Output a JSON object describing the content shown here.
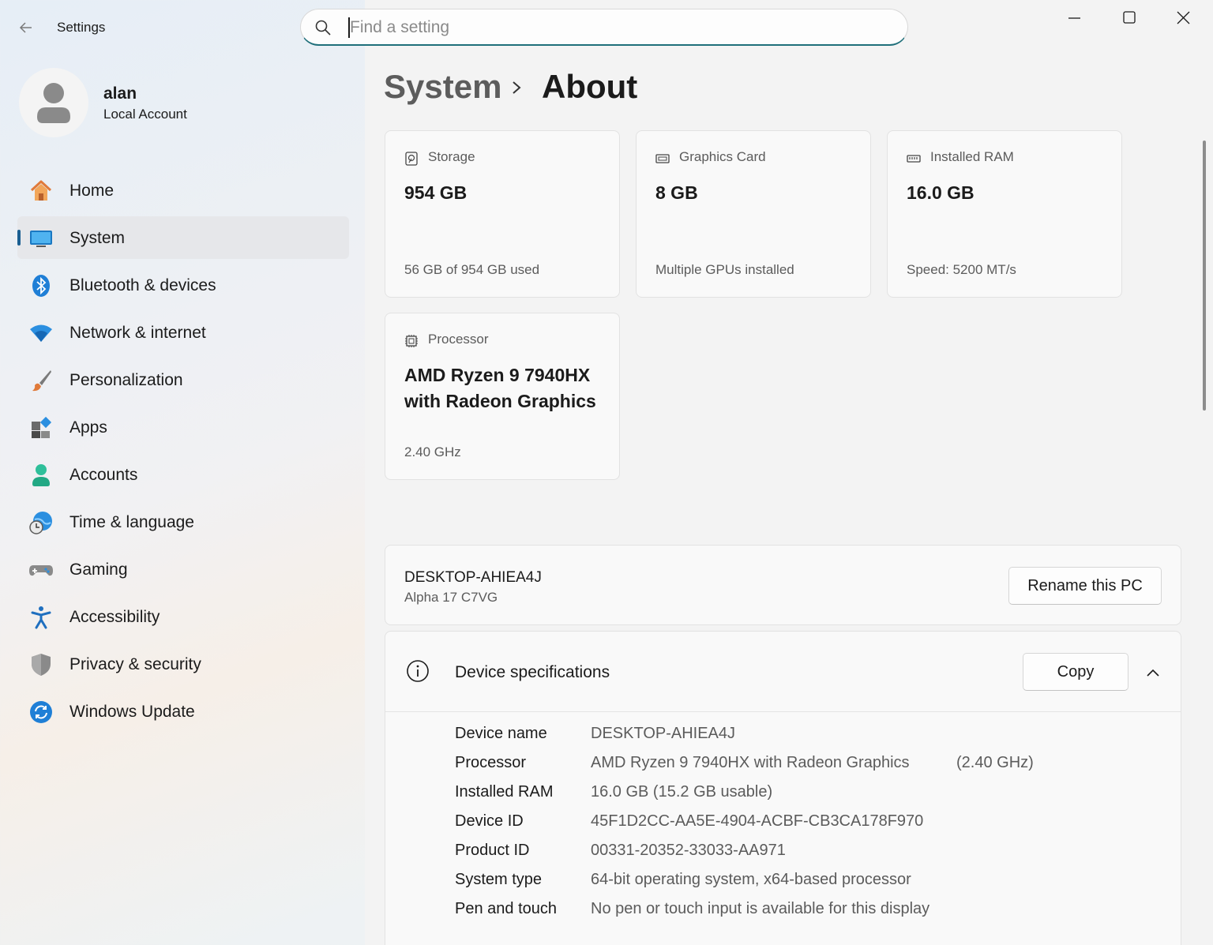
{
  "window": {
    "title": "Settings",
    "search_placeholder": "Find a setting"
  },
  "profile": {
    "name": "alan",
    "account_type": "Local Account"
  },
  "sidebar": {
    "items": [
      {
        "label": "Home",
        "icon": "home-icon"
      },
      {
        "label": "System",
        "icon": "system-icon",
        "active": true
      },
      {
        "label": "Bluetooth & devices",
        "icon": "bluetooth-icon"
      },
      {
        "label": "Network & internet",
        "icon": "wifi-icon"
      },
      {
        "label": "Personalization",
        "icon": "brush-icon"
      },
      {
        "label": "Apps",
        "icon": "apps-icon"
      },
      {
        "label": "Accounts",
        "icon": "accounts-icon"
      },
      {
        "label": "Time & language",
        "icon": "globe-clock-icon"
      },
      {
        "label": "Gaming",
        "icon": "gamepad-icon"
      },
      {
        "label": "Accessibility",
        "icon": "accessibility-icon"
      },
      {
        "label": "Privacy & security",
        "icon": "shield-icon"
      },
      {
        "label": "Windows Update",
        "icon": "update-icon"
      }
    ]
  },
  "breadcrumb": {
    "parent": "System",
    "current": "About"
  },
  "cards": {
    "storage": {
      "title": "Storage",
      "value": "954 GB",
      "sub": "56 GB of 954 GB used"
    },
    "graphics": {
      "title": "Graphics Card",
      "value": "8 GB",
      "sub": "Multiple GPUs installed"
    },
    "ram": {
      "title": "Installed RAM",
      "value": "16.0 GB",
      "sub": "Speed: 5200 MT/s"
    },
    "processor": {
      "title": "Processor",
      "value": "AMD Ryzen 9 7940HX with Radeon Graphics",
      "sub": "2.40 GHz"
    }
  },
  "pc": {
    "name": "DESKTOP-AHIEA4J",
    "model": "Alpha 17 C7VG",
    "rename_label": "Rename this PC"
  },
  "specs": {
    "title": "Device specifications",
    "copy_label": "Copy",
    "rows": [
      {
        "label": "Device name",
        "value": "DESKTOP-AHIEA4J",
        "extra": ""
      },
      {
        "label": "Processor",
        "value": "AMD Ryzen 9 7940HX with Radeon Graphics",
        "extra": "(2.40 GHz)"
      },
      {
        "label": "Installed RAM",
        "value": "16.0 GB (15.2 GB usable)",
        "extra": ""
      },
      {
        "label": "Device ID",
        "value": "45F1D2CC-AA5E-4904-ACBF-CB3CA178F970",
        "extra": ""
      },
      {
        "label": "Product ID",
        "value": "00331-20352-33033-AA971",
        "extra": ""
      },
      {
        "label": "System type",
        "value": "64-bit operating system, x64-based processor",
        "extra": ""
      },
      {
        "label": "Pen and touch",
        "value": "No pen or touch input is available for this display",
        "extra": ""
      }
    ]
  },
  "colors": {
    "accent": "#1a5f92",
    "search_underline": "#1f6f7a"
  }
}
